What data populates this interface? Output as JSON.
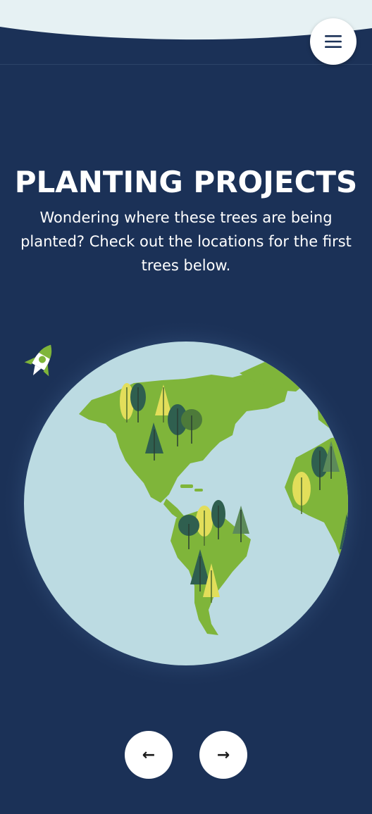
{
  "header": {
    "menu_icon": "hamburger-menu-icon"
  },
  "hero": {
    "title": "PLANTING PROJECTS",
    "subtitle": "Wondering where these trees are being planted? Check out the locations for the first trees below."
  },
  "illustration": {
    "globe": "globe-illustration",
    "rocket": "rocket-icon"
  },
  "carousel": {
    "prev_label": "←",
    "next_label": "→"
  },
  "colors": {
    "background": "#1b3157",
    "ocean": "#bcdbe2",
    "land": "#7fb53a",
    "tree_dark": "#2f5f4f",
    "tree_yellow": "#e2de5a"
  }
}
